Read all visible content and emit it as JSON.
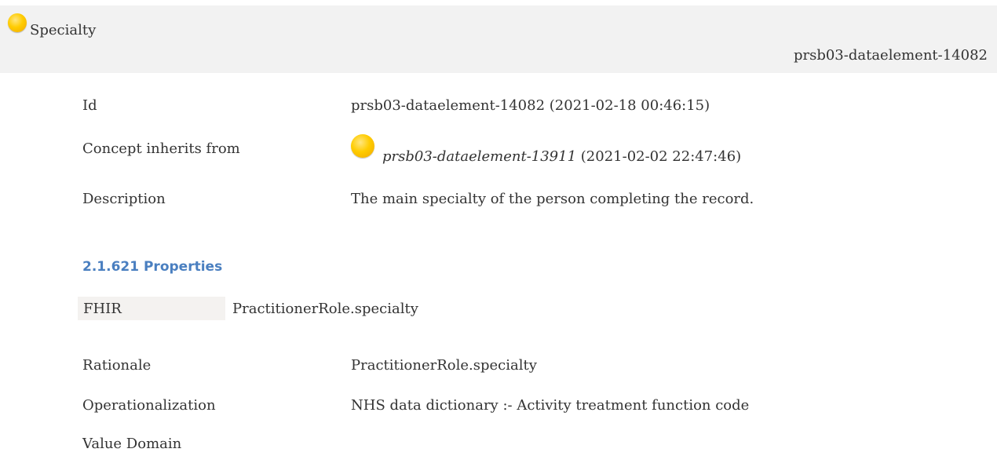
{
  "header": {
    "title": "Specialty",
    "identifier": "prsb03-dataelement-14082"
  },
  "details": {
    "id_label": "Id",
    "id_value": "prsb03-dataelement-14082 (2021-02-18 00:46:15)",
    "inherits_label": "Concept inherits from",
    "inherits_ref": "prsb03-dataelement-13911",
    "inherits_date": "(2021-02-02 22:47:46)",
    "description_label": "Description",
    "description_value": "The main specialty of the person completing the record."
  },
  "properties": {
    "heading": "2.1.621 Properties",
    "fhir_label": "FHIR",
    "fhir_value": "PractitionerRole.specialty",
    "rationale_label": "Rationale",
    "rationale_value": "PractitionerRole.specialty",
    "operationalization_label": "Operationalization",
    "operationalization_value": "NHS data dictionary :- Activity treatment function code",
    "value_domain_label": "Value Domain"
  },
  "colors": {
    "header_bg": "#f2f2f2",
    "heading": "#4a7fc0",
    "status_orb": "#ffcc00"
  },
  "icons": {
    "status": "yellow-status-orb-icon"
  }
}
